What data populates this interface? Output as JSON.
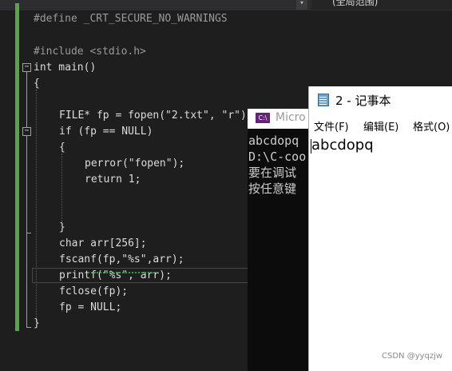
{
  "editor": {
    "scope_dropdown_icon": "chevron-down-icon",
    "scope_label": "(全局范围)",
    "fold_glyph": "−",
    "lines": [
      "#define _CRT_SECURE_NO_WARNINGS",
      "#include <stdio.h>",
      "int main()",
      "{",
      "FILE* fp = fopen(\"2.txt\", \"r\");",
      "if (fp == NULL)",
      "{",
      "perror(\"fopen\");",
      "return 1;",
      "}",
      "char arr[256];",
      "fscanf(fp,\"%s\",arr);",
      "printf(\"%s\", arr);",
      "fclose(fp);",
      "fp = NULL;",
      "}"
    ],
    "colors": {
      "background": "#1e1e1e",
      "keyword": "#569cd6",
      "string": "#d69d85",
      "change_bar": "#57a64a"
    }
  },
  "console": {
    "title": "Micro",
    "icon": "console-app-icon",
    "icon_text": "C:\\",
    "lines": [
      "abcdopq",
      "D:\\C-coo",
      "要在调试",
      "按任意键"
    ]
  },
  "notepad": {
    "title": "2 - 记事本",
    "icon": "notepad-icon",
    "menu": [
      "文件(F)",
      "编辑(E)",
      "格式(O)"
    ],
    "content": "abcdopq"
  },
  "watermark": "CSDN @yyqzjw"
}
